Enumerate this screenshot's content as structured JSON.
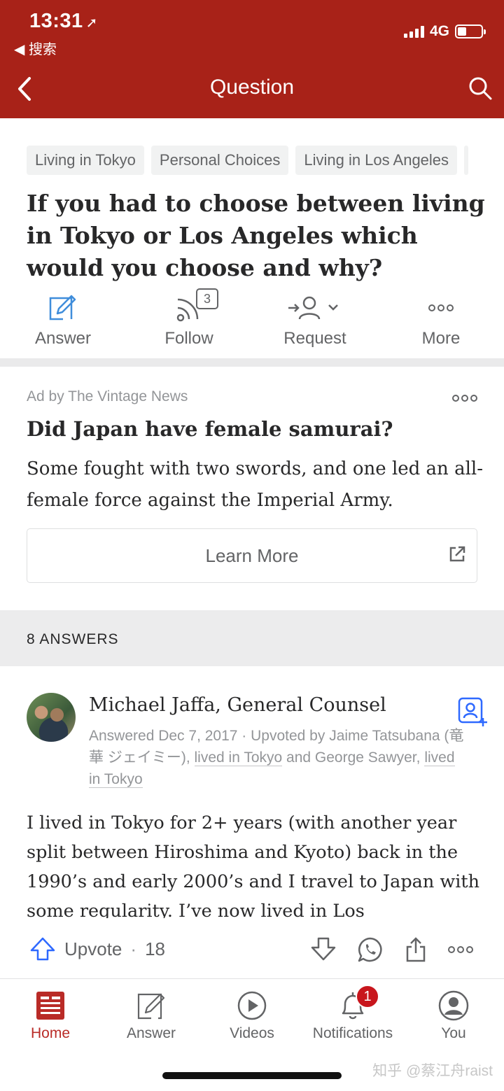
{
  "status_bar": {
    "time": "13:31",
    "back_app": "搜索",
    "network": "4G"
  },
  "nav": {
    "title": "Question"
  },
  "topics": [
    "Living in Tokyo",
    "Personal Choices",
    "Living in Los Angeles"
  ],
  "question": {
    "title": "If you had to choose between living in Tokyo or Los Angeles which would you choose and why?"
  },
  "actions": {
    "answer": "Answer",
    "follow": "Follow",
    "follow_count": "3",
    "request": "Request",
    "more": "More"
  },
  "ad": {
    "by": "Ad by The Vintage News",
    "title": "Did Japan have female samurai?",
    "body": "Some fought with two swords, and one led an all-female force against the Imperial Army.",
    "button": "Learn More"
  },
  "answers_header": "8 ANSWERS",
  "answer": {
    "author": "Michael Jaffa, General Counsel",
    "meta_prefix": "Answered Dec 7, 2017 · Upvoted by Jaime Tatsubana (竜華 ジェイミー), ",
    "meta_link1": "lived in Tokyo",
    "meta_mid": " and George Sawyer, ",
    "meta_link2": "lived in Tokyo",
    "body": "I lived in Tokyo for 2+ years (with another year split between Hiroshima and Kyoto) back in the 1990’s and early 2000’s and I travel to Japan with some regularity. I’ve now lived in Los",
    "upvote_label": "Upvote",
    "upvote_sep": "·",
    "upvote_count": "18"
  },
  "tabbar": {
    "home": "Home",
    "answer": "Answer",
    "videos": "Videos",
    "notifications": "Notifications",
    "notifications_badge": "1",
    "you": "You"
  },
  "watermark": "知乎 @蔡江舟raist",
  "colors": {
    "brand": "#a82218",
    "active_tab": "#b92b27",
    "link_blue": "#2e69ff"
  }
}
